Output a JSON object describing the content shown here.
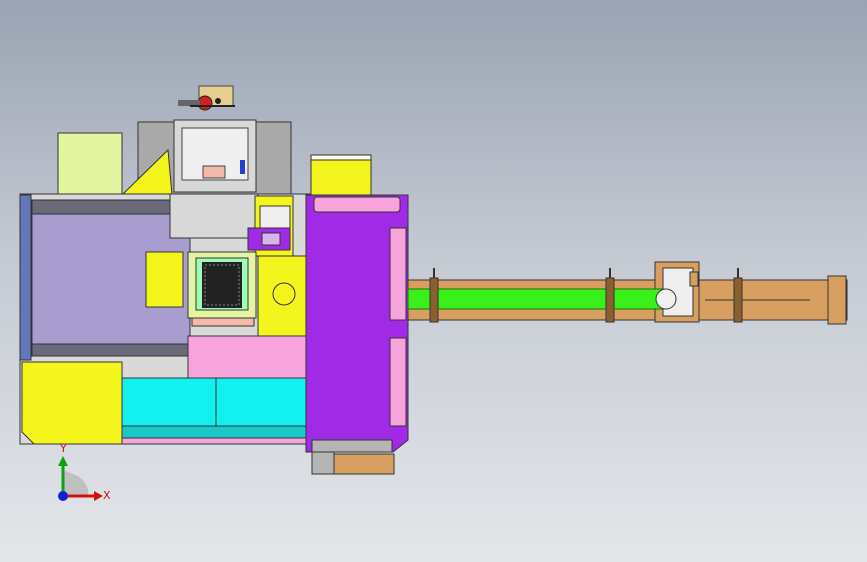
{
  "axis_triad": {
    "x_label": "X",
    "y_label": "Y",
    "x_color": "#d01010",
    "y_color": "#10a010",
    "z_color": "#1020d0"
  },
  "palette": {
    "machine_body": "#a99ccf",
    "yellow": "#f5f51e",
    "cyan": "#12f0f0",
    "pink": "#f8a4dc",
    "purple": "#a02ae6",
    "wood": "#d8a060",
    "green_bar": "#3af01a",
    "light_green": "#e3f5a0",
    "gray": "#a9a9a9"
  }
}
